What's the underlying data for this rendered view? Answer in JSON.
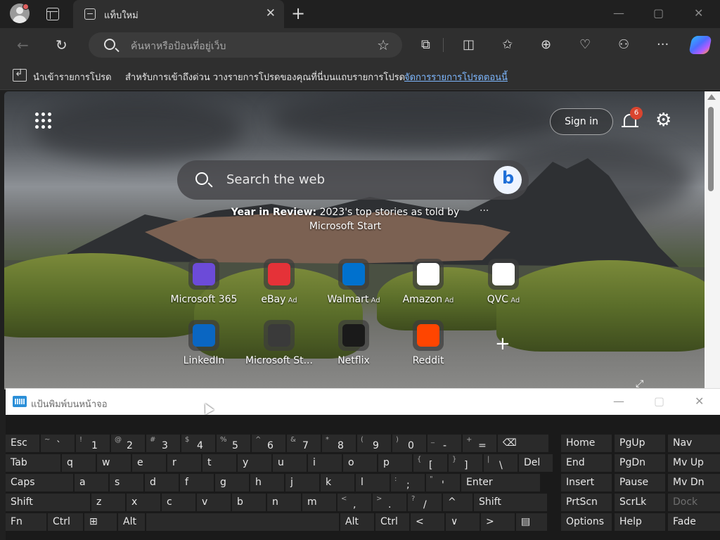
{
  "browser": {
    "tab_title": "แท็บใหม่",
    "tab_close": "✕",
    "new_tab": "+",
    "window_controls": {
      "minimize": "—",
      "maximize": "▢",
      "close": "✕"
    },
    "address_placeholder": "ค้นหาหรือป้อนที่อยู่เว็บ",
    "toolbar_icons": [
      "extensions-icon",
      "split-screen-icon",
      "favorites-icon",
      "collections-icon",
      "browser-essentials-icon",
      "workspaces-icon",
      "more-icon",
      "copilot-icon"
    ]
  },
  "favorites_bar": {
    "import_label": "นำเข้ารายการโปรด",
    "message": "สำหรับการเข้าถึงด่วน วางรายการโปรดของคุณที่นี่บนแถบรายการโปรด",
    "manage_link": "จัดการรายการโปรดตอนนี้"
  },
  "newtab": {
    "signin": "Sign in",
    "notifications_count": "6",
    "search_placeholder": "Search the web",
    "story_bold": "Year in Review:",
    "story_text": " 2023's top stories as told by Microsoft Start",
    "story_more": "···",
    "ad_label": "Ad",
    "tiles": [
      {
        "label": "Microsoft 365",
        "ad": "",
        "icon": "microsoft-365-icon",
        "color": "#6c4bd8"
      },
      {
        "label": "eBay",
        "ad": "Ad",
        "icon": "ebay-icon",
        "color": "#e53238"
      },
      {
        "label": "Walmart",
        "ad": "Ad",
        "icon": "walmart-icon",
        "color": "#0071ce"
      },
      {
        "label": "Amazon",
        "ad": "Ad",
        "icon": "amazon-icon",
        "color": "#ffffff"
      },
      {
        "label": "QVC",
        "ad": "Ad",
        "icon": "qvc-icon",
        "color": "#ffffff"
      },
      {
        "label": "LinkedIn",
        "ad": "",
        "icon": "linkedin-icon",
        "color": "#0a66c2"
      },
      {
        "label": "Microsoft St...",
        "ad": "",
        "icon": "microsoft-store-icon",
        "color": "#3a3a3a"
      },
      {
        "label": "Netflix",
        "ad": "",
        "icon": "netflix-icon",
        "color": "#1a1a1a"
      },
      {
        "label": "Reddit",
        "ad": "",
        "icon": "reddit-icon",
        "color": "#ff4500"
      }
    ],
    "add_tile": "+"
  },
  "osk": {
    "title": "แป้นพิมพ์บนหน้าจอ",
    "controls": {
      "minimize": "—",
      "maximize": "▢",
      "close": "✕"
    },
    "rows": [
      [
        {
          "main": "Esc"
        },
        {
          "shift": "~",
          "main": "`"
        },
        {
          "shift": "!",
          "main": "1"
        },
        {
          "shift": "@",
          "main": "2"
        },
        {
          "shift": "#",
          "main": "3"
        },
        {
          "shift": "$",
          "main": "4"
        },
        {
          "shift": "%",
          "main": "5"
        },
        {
          "shift": "^",
          "main": "6"
        },
        {
          "shift": "&",
          "main": "7"
        },
        {
          "shift": "*",
          "main": "8"
        },
        {
          "shift": "(",
          "main": "9"
        },
        {
          "shift": ")",
          "main": "0"
        },
        {
          "shift": "_",
          "main": "-"
        },
        {
          "shift": "+",
          "main": "="
        },
        {
          "main": "⌫"
        }
      ],
      [
        {
          "main": "Tab"
        },
        {
          "main": "q"
        },
        {
          "main": "w"
        },
        {
          "main": "e"
        },
        {
          "main": "r"
        },
        {
          "main": "t"
        },
        {
          "main": "y"
        },
        {
          "main": "u"
        },
        {
          "main": "i"
        },
        {
          "main": "o"
        },
        {
          "main": "p"
        },
        {
          "shift": "{",
          "main": "["
        },
        {
          "shift": "}",
          "main": "]"
        },
        {
          "shift": "|",
          "main": "\\"
        },
        {
          "main": "Del"
        }
      ],
      [
        {
          "main": "Caps"
        },
        {
          "main": "a"
        },
        {
          "main": "s"
        },
        {
          "main": "d"
        },
        {
          "main": "f"
        },
        {
          "main": "g"
        },
        {
          "main": "h"
        },
        {
          "main": "j"
        },
        {
          "main": "k"
        },
        {
          "main": "l"
        },
        {
          "shift": ":",
          "main": ";"
        },
        {
          "shift": "\"",
          "main": "'"
        },
        {
          "main": "Enter"
        }
      ],
      [
        {
          "main": "Shift"
        },
        {
          "main": "z"
        },
        {
          "main": "x"
        },
        {
          "main": "c"
        },
        {
          "main": "v"
        },
        {
          "main": "b"
        },
        {
          "main": "n"
        },
        {
          "main": "m"
        },
        {
          "shift": "<",
          "main": ","
        },
        {
          "shift": ">",
          "main": "."
        },
        {
          "shift": "?",
          "main": "/"
        },
        {
          "main": "^"
        },
        {
          "main": "Shift"
        }
      ],
      [
        {
          "main": "Fn"
        },
        {
          "main": "Ctrl"
        },
        {
          "main": "⊞"
        },
        {
          "main": "Alt"
        },
        {
          "main": ""
        },
        {
          "main": "Alt"
        },
        {
          "main": "Ctrl"
        },
        {
          "main": "<"
        },
        {
          "main": "∨"
        },
        {
          "main": ">"
        },
        {
          "main": "▤"
        }
      ]
    ],
    "nav_keys": [
      [
        "Home",
        "PgUp",
        "Nav"
      ],
      [
        "End",
        "PgDn",
        "Mv Up"
      ],
      [
        "Insert",
        "Pause",
        "Mv Dn"
      ],
      [
        "PrtScn",
        "ScrLk",
        "Dock"
      ],
      [
        "Options",
        "Help",
        "Fade"
      ]
    ]
  }
}
